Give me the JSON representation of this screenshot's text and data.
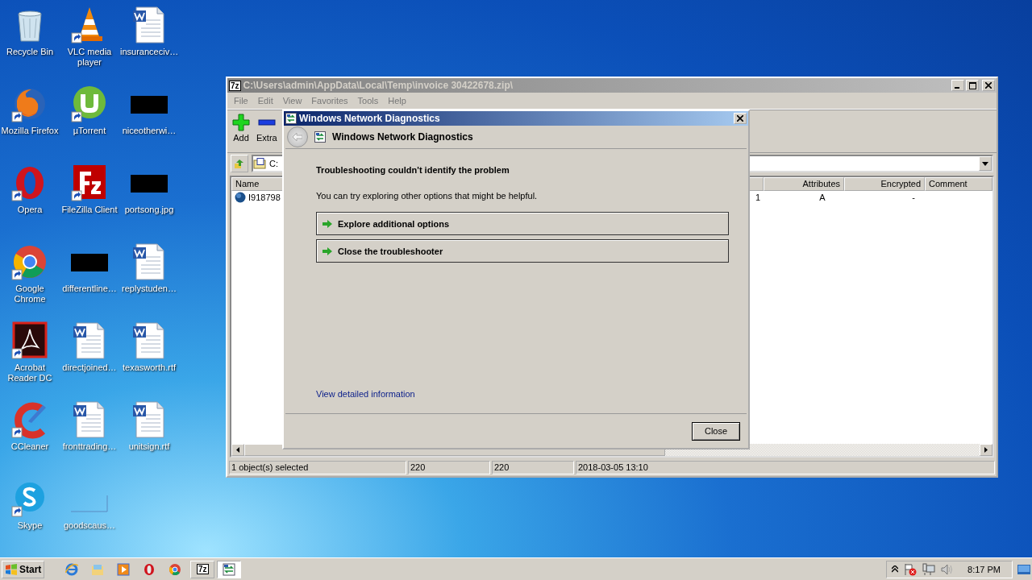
{
  "desktop_icons": [
    {
      "label": "Recycle Bin",
      "kind": "recycle",
      "shortcut": false
    },
    {
      "label": "Mozilla Firefox",
      "kind": "firefox",
      "shortcut": true
    },
    {
      "label": "Opera",
      "kind": "opera",
      "shortcut": true
    },
    {
      "label": "Google Chrome",
      "kind": "chrome",
      "shortcut": true
    },
    {
      "label": "Acrobat Reader DC",
      "kind": "acrobat",
      "shortcut": true
    },
    {
      "label": "CCleaner",
      "kind": "ccleaner",
      "shortcut": true
    },
    {
      "label": "Skype",
      "kind": "skype",
      "shortcut": true
    },
    {
      "label": "VLC media player",
      "kind": "vlc",
      "shortcut": true
    },
    {
      "label": "µTorrent",
      "kind": "utorrent",
      "shortcut": true
    },
    {
      "label": "FileZilla Client",
      "kind": "filezilla",
      "shortcut": true
    },
    {
      "label": "differentline…",
      "kind": "dark-image",
      "shortcut": false
    },
    {
      "label": "directjoined…",
      "kind": "document",
      "shortcut": false
    },
    {
      "label": "fronttrading…",
      "kind": "document",
      "shortcut": false
    },
    {
      "label": "goodscaus…",
      "kind": "blank-image",
      "shortcut": false
    },
    {
      "label": "insuranceciv…",
      "kind": "document",
      "shortcut": false
    },
    {
      "label": "niceotherwi…",
      "kind": "dark-image",
      "shortcut": false
    },
    {
      "label": "portsong.jpg",
      "kind": "dark-image",
      "shortcut": false
    },
    {
      "label": "replystuden…",
      "kind": "document",
      "shortcut": false
    },
    {
      "label": "texasworth.rtf",
      "kind": "document",
      "shortcut": false
    },
    {
      "label": "unitsign.rtf",
      "kind": "document",
      "shortcut": false
    }
  ],
  "archive_window": {
    "app_badge": "7z",
    "title": "C:\\Users\\admin\\AppData\\Local\\Temp\\invoice 30422678.zip\\",
    "active": false,
    "menu": [
      "File",
      "Edit",
      "View",
      "Favorites",
      "Tools",
      "Help"
    ],
    "toolbar": [
      {
        "label": "Add",
        "kind": "add"
      },
      {
        "label": "Extra",
        "kind": "extract"
      }
    ],
    "address": "C:",
    "columns": [
      "Name",
      "Attributes",
      "Encrypted",
      "Comment"
    ],
    "rows": [
      {
        "name": "I918798",
        "column_2": "1",
        "attributes": "A",
        "encrypted": "-"
      }
    ],
    "status": [
      "1 object(s) selected",
      "220",
      "220",
      "2018-03-05 13:10"
    ]
  },
  "dialog": {
    "title": "Windows Network Diagnostics",
    "active": true,
    "header": "Windows Network Diagnostics",
    "heading": "Troubleshooting couldn't identify the problem",
    "text": "You can try exploring other options that might be helpful.",
    "options": [
      "Explore additional options",
      "Close the troubleshooter"
    ],
    "link": "View detailed information",
    "button": "Close"
  },
  "taskbar": {
    "start": "Start",
    "tasks": [
      {
        "label": "7z",
        "kind": "archive",
        "selected": false
      },
      {
        "kind": "diagnostics",
        "selected": true
      }
    ],
    "clock": "8:17 PM"
  }
}
